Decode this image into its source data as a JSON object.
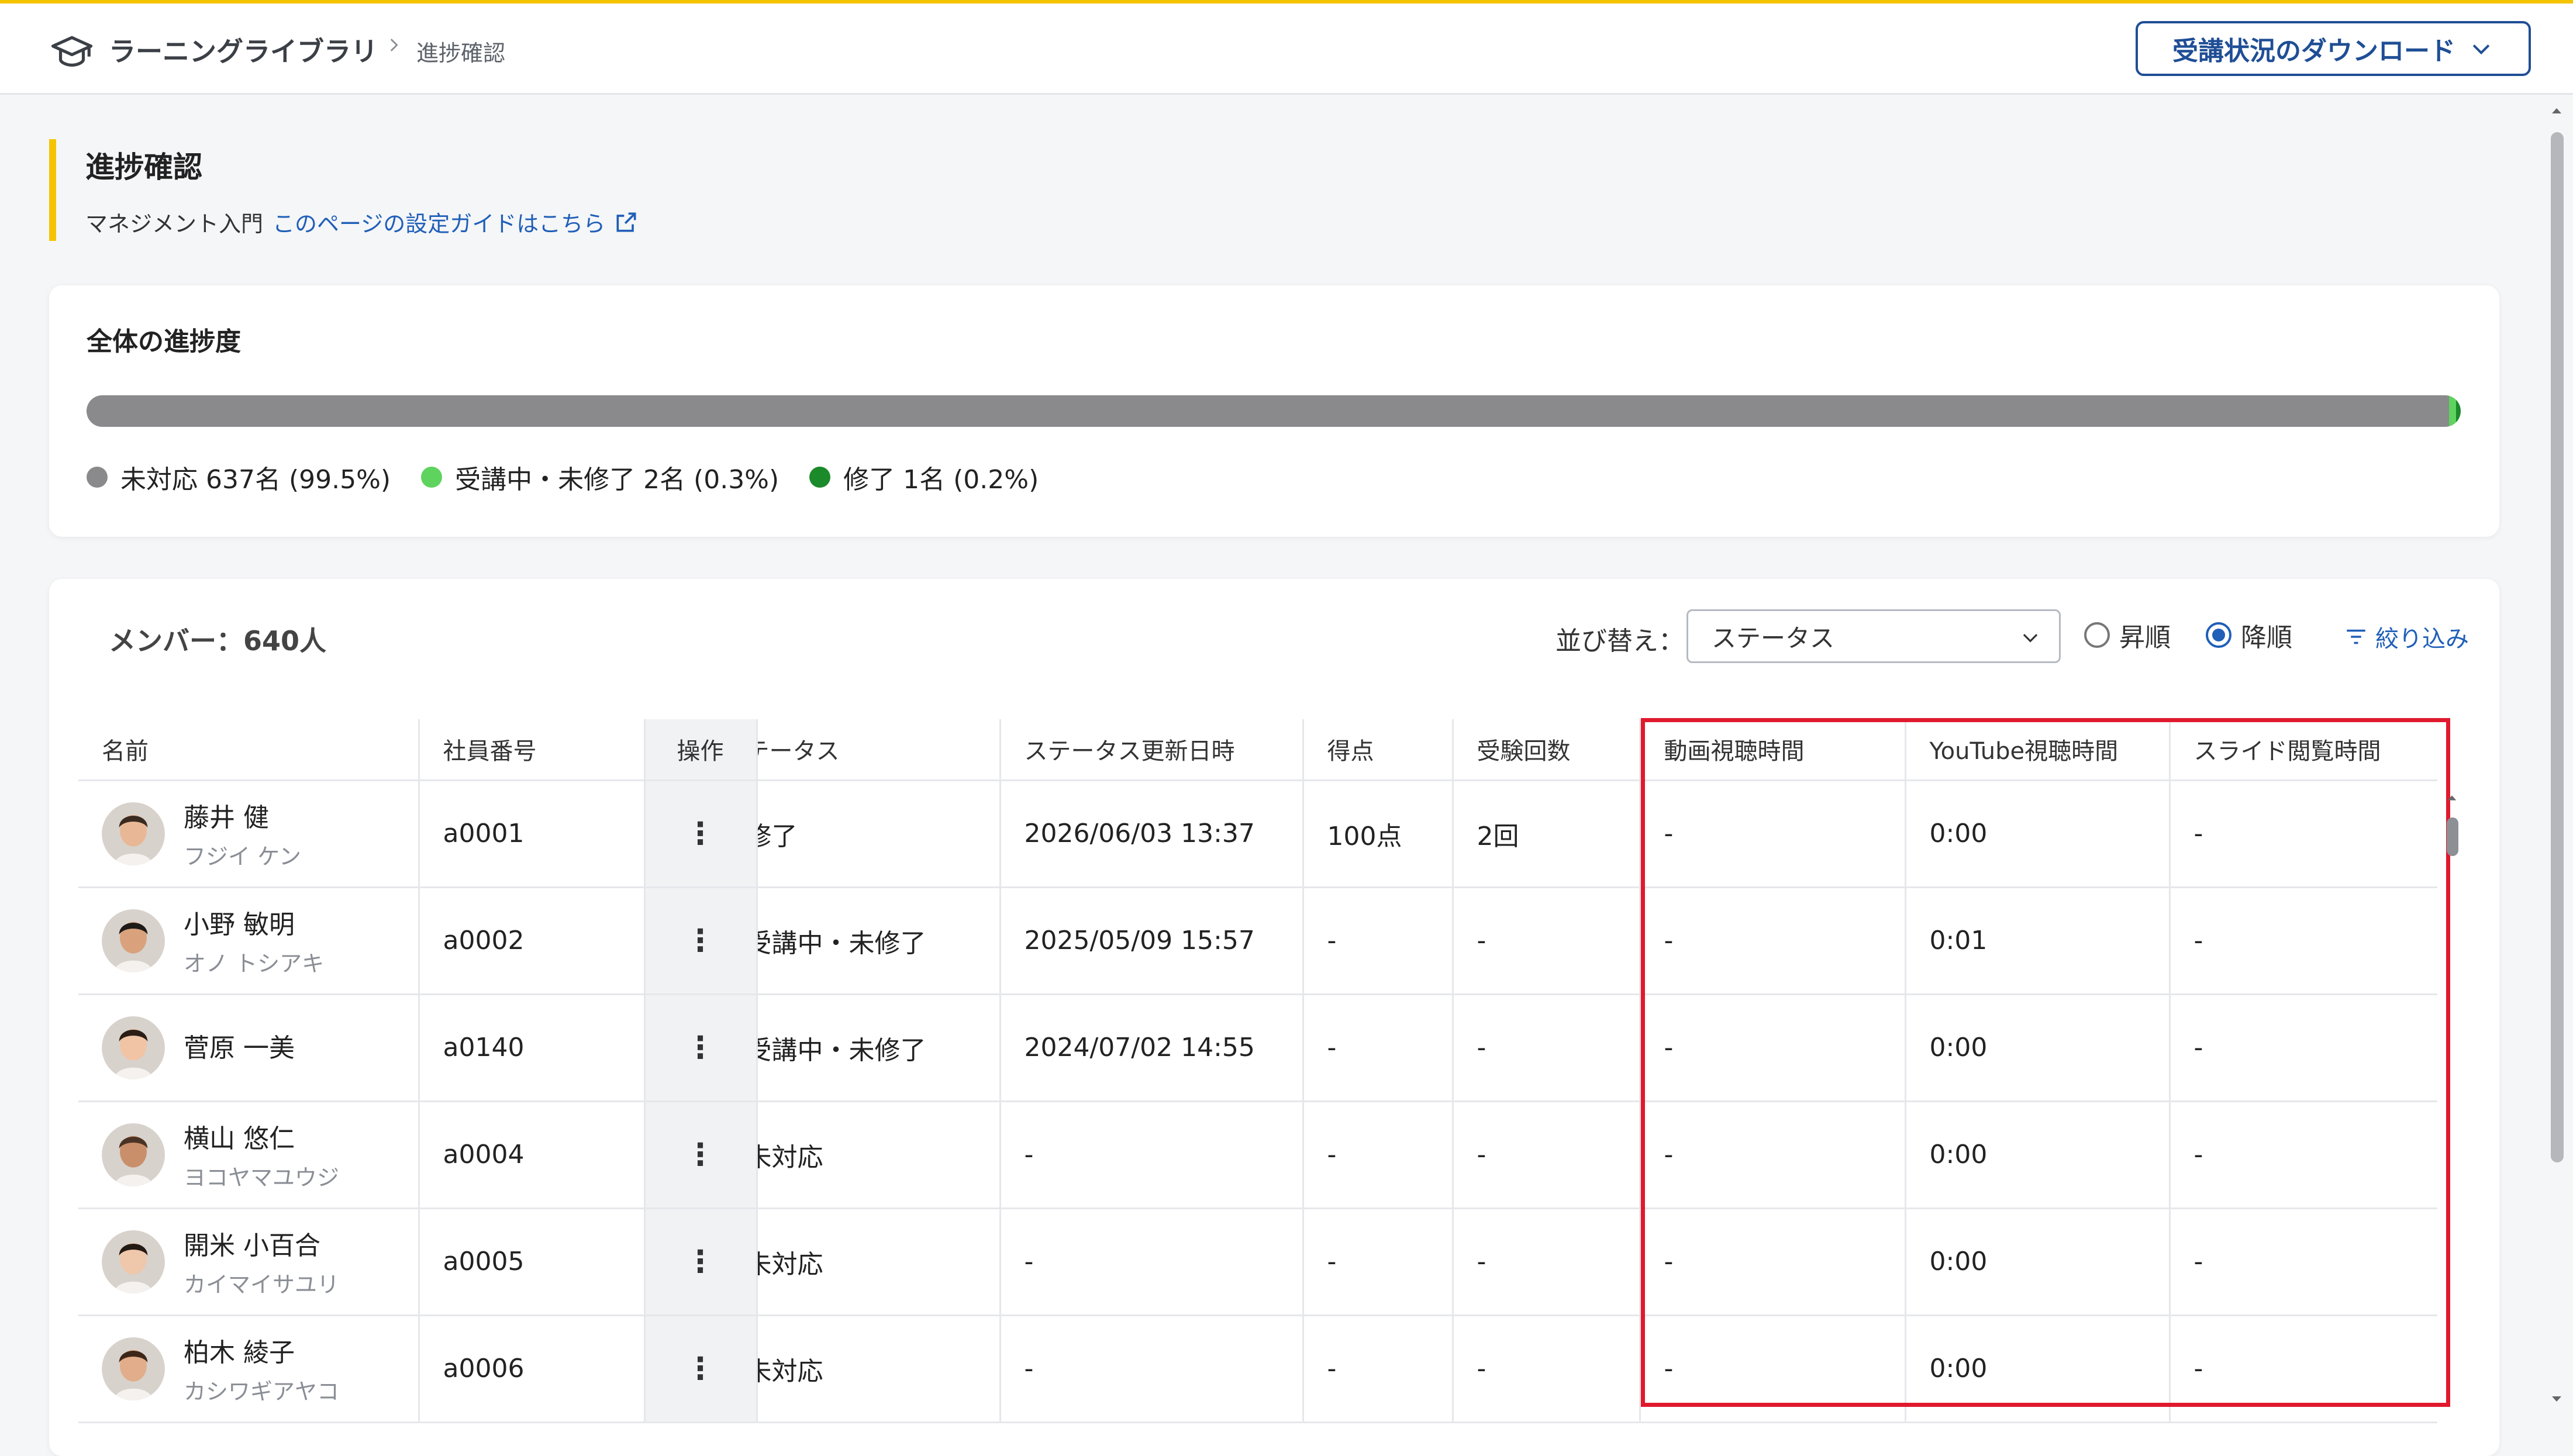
{
  "header": {
    "breadcrumb_root": "ラーニングライブラリ",
    "breadcrumb_current": "進捗確認",
    "download_label": "受講状況のダウンロード",
    "icons": {
      "logo": "graduation-cap-icon",
      "separator": "chevron-right-icon",
      "download": "chevron-down-icon"
    }
  },
  "page": {
    "title": "進捗確認",
    "course": "マネジメント入門",
    "guide_link": "このページの設定ガイドはこちら",
    "guide_icon": "external-link-icon"
  },
  "progress": {
    "title": "全体の進捗度",
    "segments": [
      {
        "label": "未対応 637名 (99.5%)",
        "percent": 99.5,
        "color": "#8a8a8d"
      },
      {
        "label": "受講中・未修了 2名 (0.3%)",
        "percent": 0.3,
        "color": "#5ed35e"
      },
      {
        "label": "修了 1名 (0.2%)",
        "percent": 0.2,
        "color": "#1b8a2a"
      }
    ]
  },
  "table": {
    "member_count": "メンバー：640人",
    "sort_label": "並び替え：",
    "sort_value": "ステータス",
    "order_asc": "昇順",
    "order_desc": "降順",
    "order_selected": "desc",
    "filter_label": "絞り込み",
    "columns": {
      "name": "名前",
      "id": "社員番号",
      "op": "操作",
      "status": "テータス",
      "updated": "ステータス更新日時",
      "score": "得点",
      "attempts": "受験回数",
      "video": "動画視聴時間",
      "youtube": "YouTube視聴時間",
      "slide": "スライド閲覧時間"
    },
    "rows": [
      {
        "name": "藤井 健",
        "kana": "フジイ ケン",
        "id": "a0001",
        "op": "⋮",
        "status": "修了",
        "updated": "2026/06/03 13:37",
        "score": "100点",
        "attempts": "2回",
        "video": "-",
        "youtube": "0:00",
        "slide": "-"
      },
      {
        "name": "小野 敏明",
        "kana": "オノ トシアキ",
        "id": "a0002",
        "op": "⋮",
        "status": "受講中・未修了",
        "updated": "2025/05/09 15:57",
        "score": "-",
        "attempts": "-",
        "video": "-",
        "youtube": "0:01",
        "slide": "-"
      },
      {
        "name": "菅原 一美",
        "kana": "",
        "id": "a0140",
        "op": "⋮",
        "status": "受講中・未修了",
        "updated": "2024/07/02 14:55",
        "score": "-",
        "attempts": "-",
        "video": "-",
        "youtube": "0:00",
        "slide": "-"
      },
      {
        "name": "横山 悠仁",
        "kana": "ヨコヤマユウジ",
        "id": "a0004",
        "op": "⋮",
        "status": "未対応",
        "updated": "-",
        "score": "-",
        "attempts": "-",
        "video": "-",
        "youtube": "0:00",
        "slide": "-"
      },
      {
        "name": "開米 小百合",
        "kana": "カイマイサユリ",
        "id": "a0005",
        "op": "⋮",
        "status": "未対応",
        "updated": "-",
        "score": "-",
        "attempts": "-",
        "video": "-",
        "youtube": "0:00",
        "slide": "-"
      },
      {
        "name": "柏木 綾子",
        "kana": "カシワギアヤコ",
        "id": "a0006",
        "op": "⋮",
        "status": "未対応",
        "updated": "-",
        "score": "-",
        "attempts": "-",
        "video": "-",
        "youtube": "0:00",
        "slide": "-"
      }
    ]
  },
  "colors": {
    "accent_yellow": "#f5c400",
    "link_blue": "#1f5fb8",
    "button_navy": "#1f4e95",
    "highlight_red": "#e0192d"
  }
}
